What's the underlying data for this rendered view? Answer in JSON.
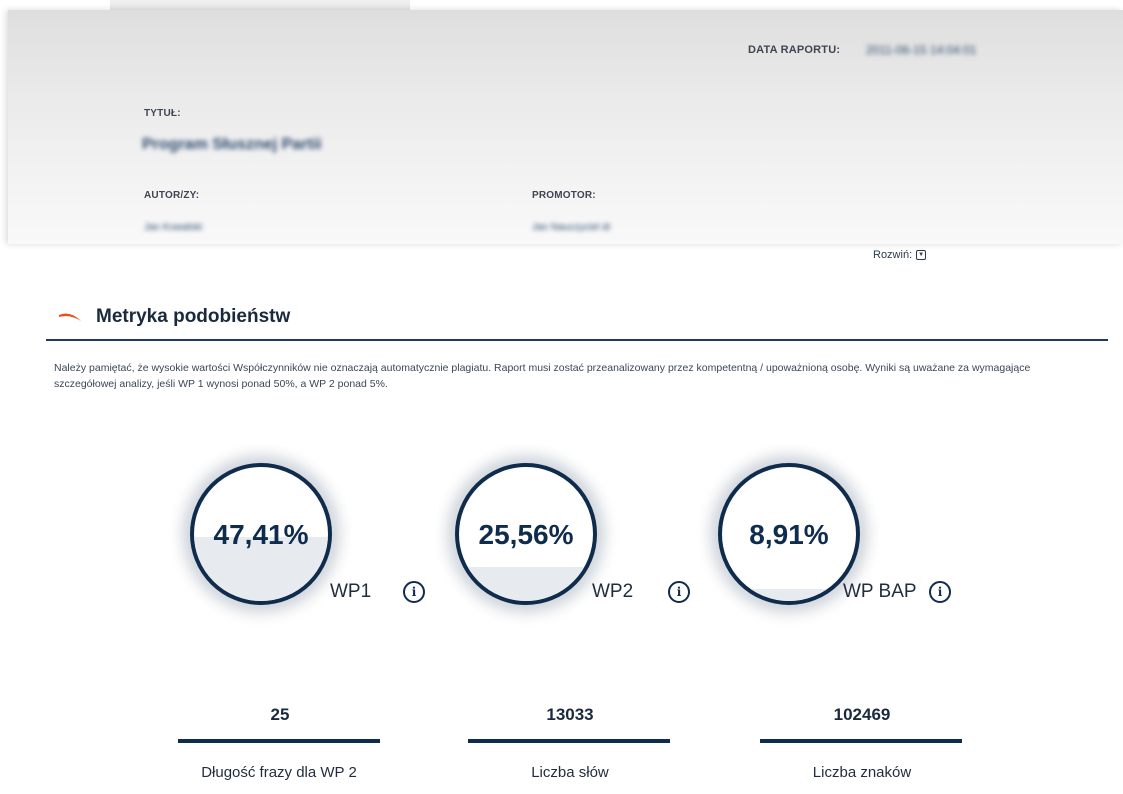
{
  "header": {
    "report_date_label": "DATA RAPORTU:",
    "report_date_value": "2011-06-15 14:04:01",
    "title_label": "TYTUŁ:",
    "title_value": "Program Słusznej Partii",
    "author_label": "AUTOR/ZY:",
    "author_value": "Jan Kowalski",
    "promoter_label": "PROMOTOR:",
    "promoter_value": "Jan Nauczyciel dr",
    "expand_label": "Rozwiń:"
  },
  "section": {
    "title": "Metryka podobieństw",
    "description": "Należy pamiętać, że wysokie wartości Współczynników nie oznaczają automatycznie plagiatu. Raport musi zostać przeanalizowany przez kompetentną / upoważnioną osobę. Wyniki są uważane za wymagające szczegółowej analizy, jeśli WP 1 wynosi ponad 50%, a WP 2 ponad 5%."
  },
  "gauges": [
    {
      "value_text": "47,41%",
      "fill_fraction": 0.4741,
      "label": "WP1",
      "info": "i"
    },
    {
      "value_text": "25,56%",
      "fill_fraction": 0.2556,
      "label": "WP2",
      "info": "i"
    },
    {
      "value_text": "8,91%",
      "fill_fraction": 0.0891,
      "label": "WP BAP",
      "info": "i"
    }
  ],
  "stats": [
    {
      "value": "25",
      "label": "Długość frazy dla WP 2"
    },
    {
      "value": "13033",
      "label": "Liczba słów"
    },
    {
      "value": "102469",
      "label": "Liczba znaków"
    }
  ],
  "colors": {
    "navy": "#0f2c4d",
    "accent_orange": "#e8501e",
    "gauge_fill": "#e7ebf0"
  }
}
